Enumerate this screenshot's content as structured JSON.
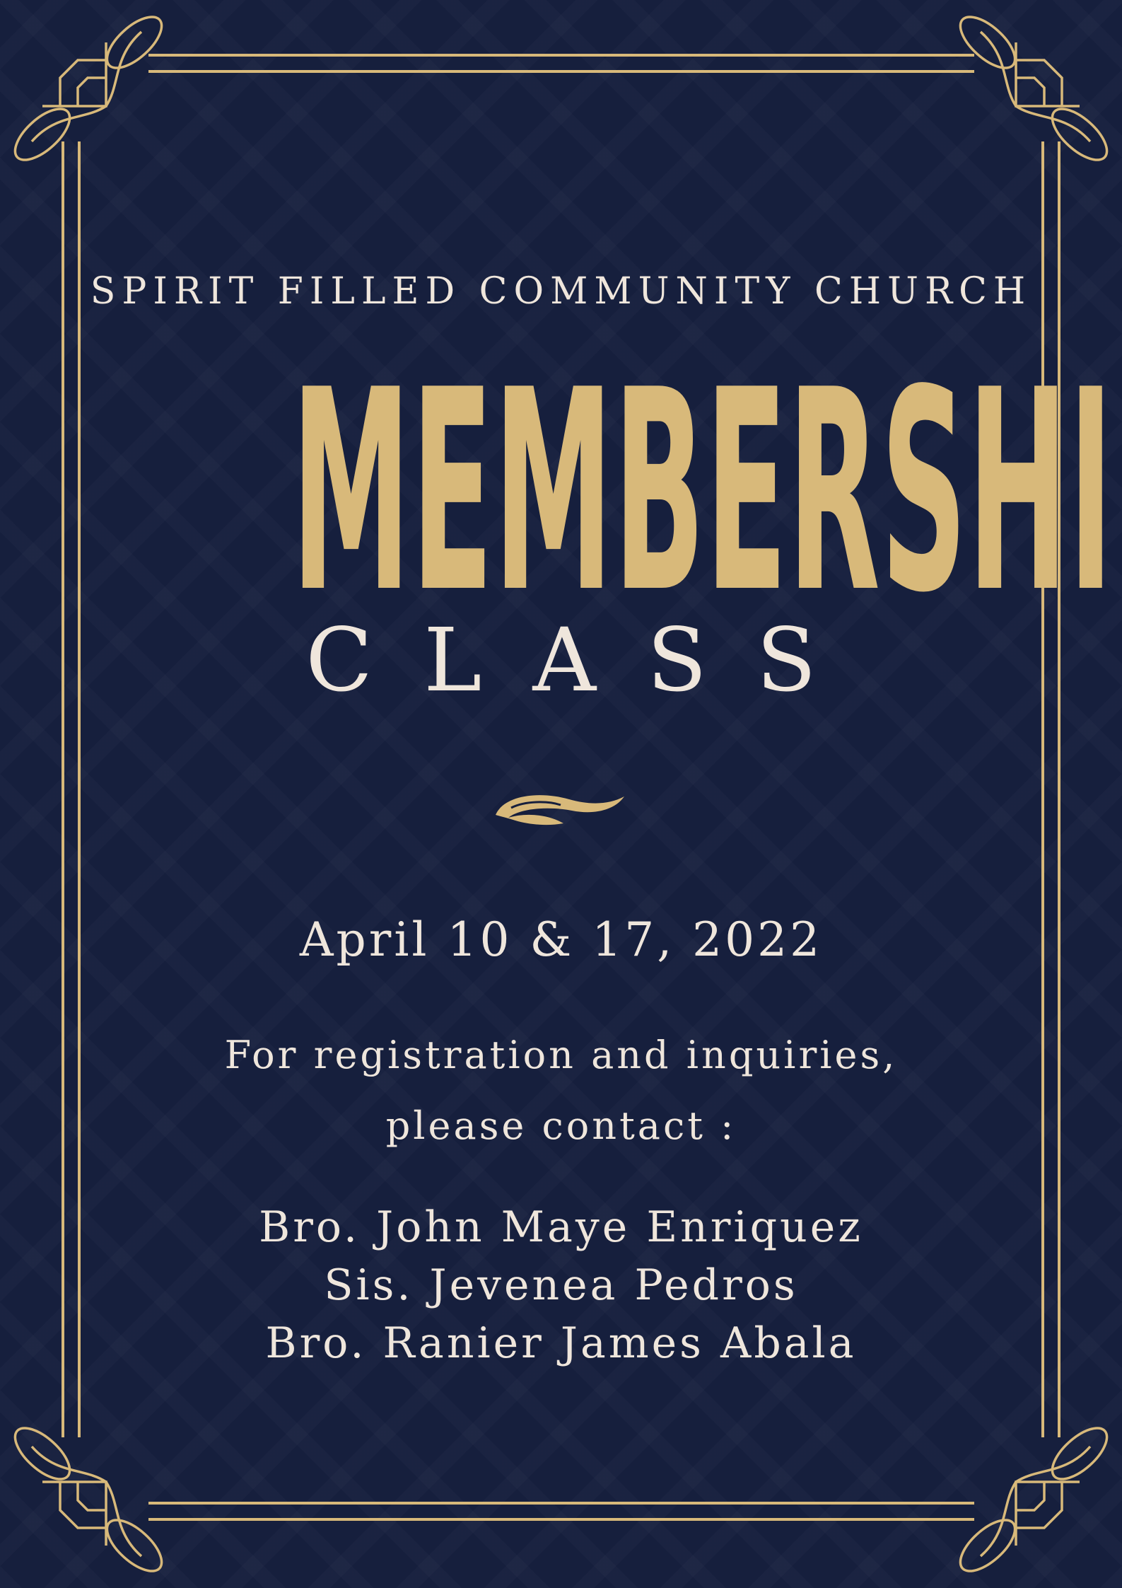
{
  "poster": {
    "church_name": "SPIRIT FILLED COMMUNITY CHURCH",
    "title": "MEMBERSHIP",
    "subtitle": "CLASS",
    "date": "April 10 & 17, 2022",
    "contact_line_1": "For registration and inquiries,",
    "contact_line_2": "please contact :",
    "contacts": [
      "Bro. John Maye Enriquez",
      "Sis. Jevenea Pedros",
      "Bro. Ranier James Abala"
    ]
  },
  "colors": {
    "background": "#161f3d",
    "gold": "#d8b97a",
    "cream": "#efe6dc"
  },
  "icons": {
    "corner_ornament": "ornate-corner-knot-icon",
    "divider": "swash-flourish-icon"
  }
}
